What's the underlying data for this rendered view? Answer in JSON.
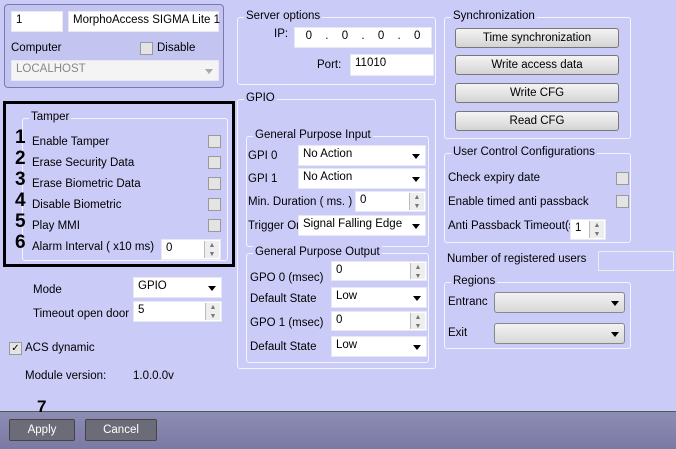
{
  "header": {
    "id": "1",
    "name": "MorphoAccess SIGMA Lite 1",
    "computer_label": "Computer",
    "disable_label": "Disable",
    "computer_value": "LOCALHOST"
  },
  "tamper": {
    "title": "Tamper",
    "items": [
      {
        "n": "1",
        "label": "Enable Tamper"
      },
      {
        "n": "2",
        "label": "Erase Security Data"
      },
      {
        "n": "3",
        "label": "Erase Biometric Data"
      },
      {
        "n": "4",
        "label": "Disable Biometric"
      },
      {
        "n": "5",
        "label": "Play MMI"
      },
      {
        "n": "6",
        "label": "Alarm Interval ( x10 ms)",
        "value": "0"
      }
    ]
  },
  "left": {
    "mode_label": "Mode",
    "mode_value": "GPIO",
    "timeout_label": "Timeout open door",
    "timeout_value": "5",
    "acs_label": "ACS dynamic",
    "module_label": "Module version:",
    "module_value": "1.0.0.0v"
  },
  "server": {
    "title": "Server options",
    "ip_label": "IP:",
    "ip": [
      "0",
      "0",
      "0",
      "0"
    ],
    "port_label": "Port:",
    "port": "11010"
  },
  "gpio": {
    "title": "GPIO",
    "gpi_title": "General Purpose Input",
    "gpi0_label": "GPI 0",
    "gpi0": "No Action",
    "gpi1_label": "GPI 1",
    "gpi1": "No Action",
    "min_label": "Min. Duration ( ms. )",
    "min": "0",
    "trigger_label": "Trigger On",
    "trigger": "Signal Falling Edge",
    "gpo_title": "General Purpose Output",
    "gpo0_label": "GPO 0 (msec)",
    "gpo0": "0",
    "ds0_label": "Default State",
    "ds0": "Low",
    "gpo1_label": "GPO 1 (msec)",
    "gpo1": "0",
    "ds1_label": "Default State",
    "ds1": "Low"
  },
  "sync": {
    "title": "Synchronization",
    "buttons": [
      "Time synchronization",
      "Write access data",
      "Write CFG",
      "Read CFG"
    ]
  },
  "ucc": {
    "title": "User Control Configurations",
    "expiry": "Check expiry date",
    "timed": "Enable timed anti passback",
    "apb_label": "Anti Passback Timeout(s)",
    "apb": "1"
  },
  "users_label": "Number of registered users",
  "regions": {
    "title": "Regions",
    "entrance": "Entranc",
    "exit": "Exit"
  },
  "footer": {
    "marker": "7",
    "apply": "Apply",
    "cancel": "Cancel"
  }
}
